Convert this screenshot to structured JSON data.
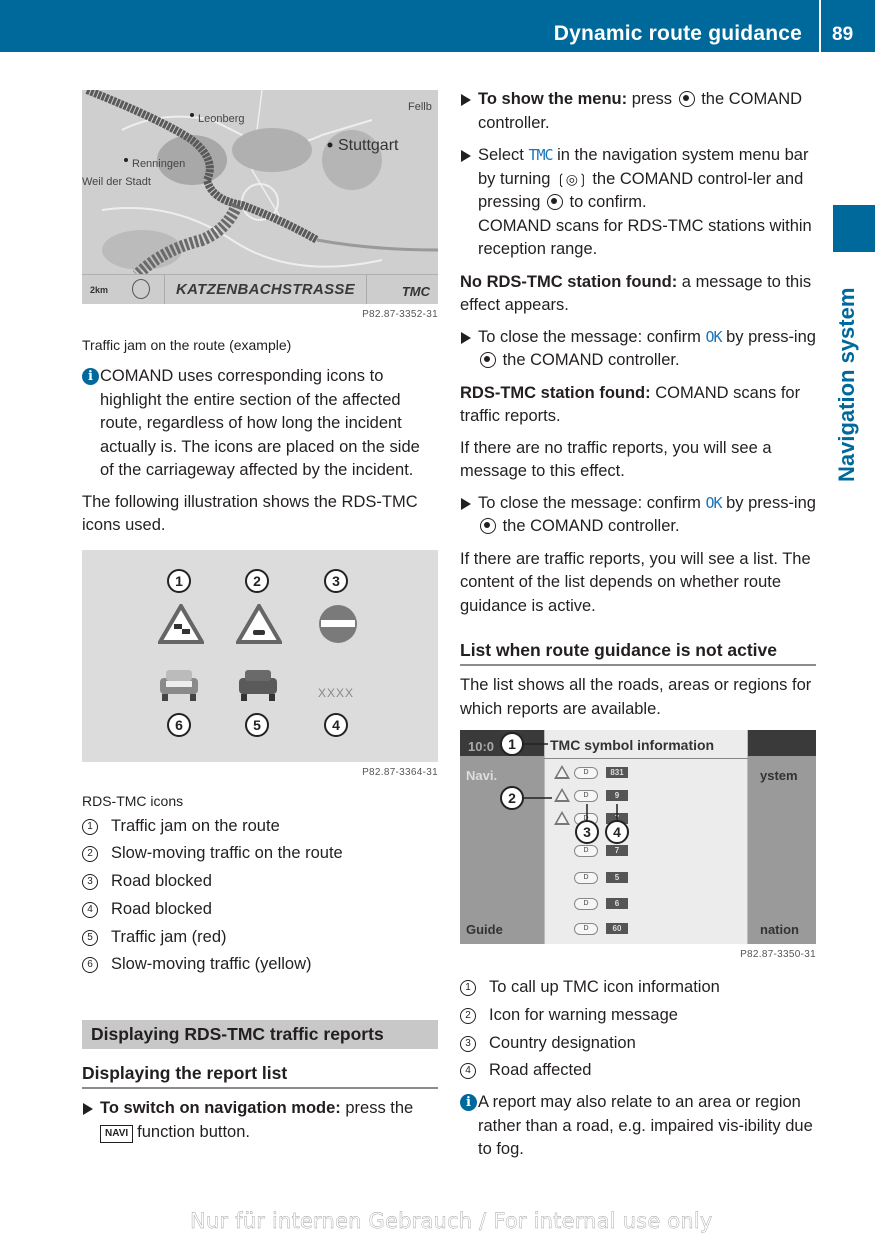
{
  "header": {
    "title": "Dynamic route guidance",
    "page_number": "89"
  },
  "side_tab": {
    "label": "Navigation system",
    "accent_color": "#00699b"
  },
  "left_column": {
    "map_figure": {
      "labels": {
        "city_large": "Stuttgart",
        "city_1": "Leonberg",
        "city_2": "Renningen",
        "city_3": "Weil der Stadt",
        "city_4": "Fellb"
      },
      "status_bar": {
        "scale": "2km",
        "street": "KATZENBACHSTRASSE",
        "tmc_logo": "TMC"
      },
      "code": "P82.87-3352-31",
      "caption": "Traffic jam on the route (example)"
    },
    "info_note_1": "COMAND uses corresponding icons to highlight the entire section of the affected route, regardless of how long the incident actually is. The icons are placed on the side of the carriageway affected by the incident.",
    "intro_illustration": "The following illustration shows the RDS-TMC icons used.",
    "icons_figure": {
      "callouts": [
        "1",
        "2",
        "3",
        "6",
        "5",
        "4"
      ],
      "placeholder_text": "XXXX",
      "code": "P82.87-3364-31",
      "caption": "RDS-TMC icons"
    },
    "icon_legend": [
      {
        "num": "1",
        "text": "Traffic jam on the route"
      },
      {
        "num": "2",
        "text": "Slow-moving traffic on the route"
      },
      {
        "num": "3",
        "text": "Road blocked"
      },
      {
        "num": "4",
        "text": "Road blocked"
      },
      {
        "num": "5",
        "text": "Traffic jam (red)"
      },
      {
        "num": "6",
        "text": "Slow-moving traffic (yellow)"
      }
    ],
    "section_title": "Displaying RDS-TMC traffic reports",
    "subsection_title": "Displaying the report list",
    "step_nav_mode": {
      "bold": "To switch on navigation mode:",
      "text_before_key": " press the",
      "key": "NAVI",
      "text_after_key": "function button."
    }
  },
  "right_column": {
    "step_show_menu": {
      "bold": "To show the menu:",
      "text_1": " press",
      "text_2": " the COMAND controller."
    },
    "step_select_tmc": {
      "text_1": "Select ",
      "highlight": "TMC",
      "text_2": " in the navigation system menu bar by turning",
      "text_3": " the COMAND control-ler and pressing",
      "text_4": " to confirm.",
      "result": "COMAND scans for RDS-TMC stations within reception range."
    },
    "no_station": {
      "bold": "No RDS-TMC station found:",
      "text": " a message to this effect appears."
    },
    "step_close_1": {
      "text_1": "To close the message: confirm ",
      "highlight": "OK",
      "text_2": " by press-ing",
      "text_3": " the COMAND controller."
    },
    "station_found": {
      "bold": "RDS-TMC station found:",
      "text": " COMAND scans for traffic reports."
    },
    "no_reports": "If there are no traffic reports, you will see a message to this effect.",
    "step_close_2": {
      "text_1": "To close the message: confirm ",
      "highlight": "OK",
      "text_2": " by press-ing",
      "text_3": " the COMAND controller."
    },
    "reports_list": "If there are traffic reports, you will see a list. The content of the list depends on whether route guidance is active.",
    "subsection_title": "List when route guidance is not active",
    "list_intro": "The list shows all the roads, areas or regions for which reports are available.",
    "tmc_figure": {
      "clock": "10:0",
      "title": "TMC symbol information",
      "left_menu": "Navi.",
      "left_bottom": "Guide",
      "right_menu": "ystem",
      "right_bottom": "nation",
      "rows": [
        {
          "country": "D",
          "road": "831"
        },
        {
          "country": "D",
          "road": "9"
        },
        {
          "country": "D",
          "road": "7"
        },
        {
          "country": "D",
          "road": "7"
        },
        {
          "country": "D",
          "road": "5"
        },
        {
          "country": "D",
          "road": "6"
        },
        {
          "country": "D",
          "road": "60"
        }
      ],
      "callouts": [
        "1",
        "2",
        "3",
        "4"
      ],
      "code": "P82.87-3350-31"
    },
    "figure_legend": [
      {
        "num": "1",
        "text": "To call up TMC icon information"
      },
      {
        "num": "2",
        "text": "Icon for warning message"
      },
      {
        "num": "3",
        "text": "Country designation"
      },
      {
        "num": "4",
        "text": "Road affected"
      }
    ],
    "info_note_2": "A report may also relate to an area or region rather than a road, e.g. impaired vis-ibility due to fog."
  },
  "footer": {
    "watermark": "Nur für internen Gebrauch / For internal use only"
  }
}
